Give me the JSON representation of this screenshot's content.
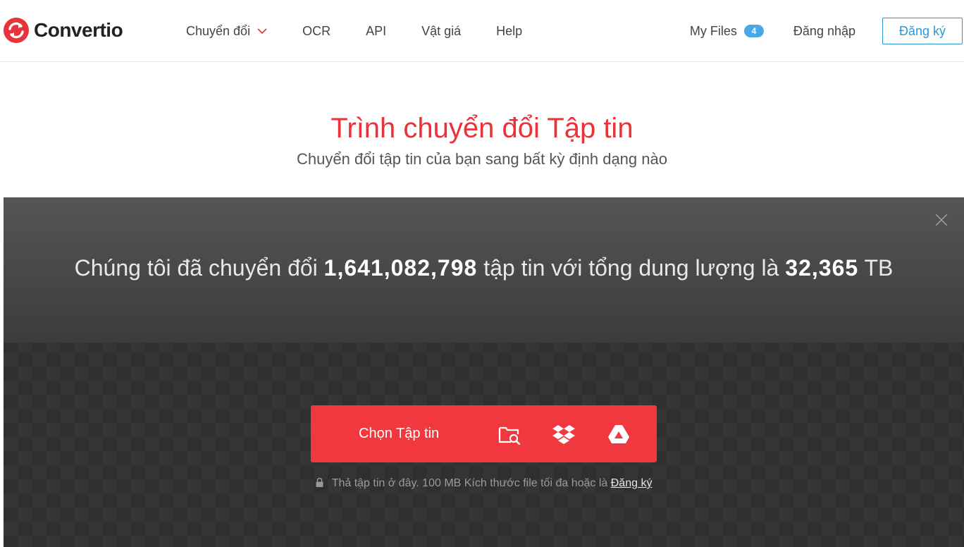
{
  "header": {
    "brand": "Convertio",
    "nav": [
      {
        "label": "Chuyển đổi",
        "has_dropdown": true
      },
      {
        "label": "OCR"
      },
      {
        "label": "API"
      },
      {
        "label": "Vật giá"
      },
      {
        "label": "Help"
      }
    ],
    "my_files": {
      "label": "My Files",
      "count": "4"
    },
    "login_label": "Đăng nhập",
    "signup_label": "Đăng ký"
  },
  "hero": {
    "title": "Trình chuyển đổi Tập tin",
    "subtitle": "Chuyển đổi tập tin của bạn sang bất kỳ định dạng nào"
  },
  "stats": {
    "prefix": "Chúng tôi đã chuyển đổi",
    "files_count": "1,641,082,798",
    "middle": "tập tin với tổng dung lượng là",
    "total_size": "32,365",
    "unit": "TB"
  },
  "uploader": {
    "choose_label": "Chọn Tập tin",
    "sources": [
      "folder-search-icon",
      "dropbox-icon",
      "google-drive-icon"
    ],
    "note_text": "Thả tập tin ở đây. 100 MB Kích thước file tối đa hoặc là",
    "note_link": "Đăng ký"
  },
  "colors": {
    "brand_red": "#f1383e",
    "title_red": "#e8333a",
    "badge_blue": "#4aa8e8",
    "signup_blue": "#2a9ad4"
  }
}
